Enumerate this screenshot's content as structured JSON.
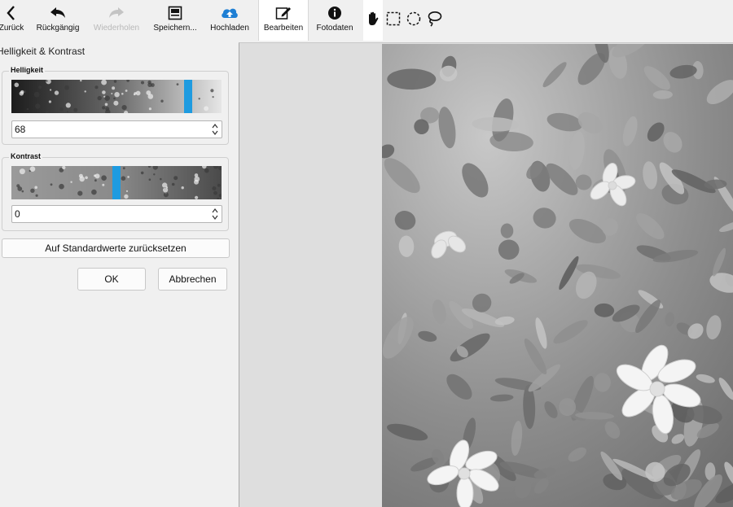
{
  "toolbar": {
    "back": "Zurück",
    "undo": "Rückgängig",
    "redo": "Wiederholen",
    "save": "Speichern...",
    "upload": "Hochladen",
    "edit": "Bearbeiten",
    "photo_info": "Fotodaten"
  },
  "tools": [
    "hand-icon",
    "rect-select-icon",
    "ellipse-select-icon",
    "lasso-icon"
  ],
  "panel": {
    "title": "Helligkeit & Kontrast",
    "brightness": {
      "label": "Helligkeit",
      "value": "68",
      "slider_fraction": 0.84
    },
    "contrast": {
      "label": "Kontrast",
      "value": "0",
      "slider_fraction": 0.5
    },
    "reset": "Auf Standardwerte zurücksetzen",
    "ok": "OK",
    "cancel": "Abbrechen"
  },
  "colors": {
    "accent": "#1e9be0",
    "upload": "#1e7fd4"
  }
}
